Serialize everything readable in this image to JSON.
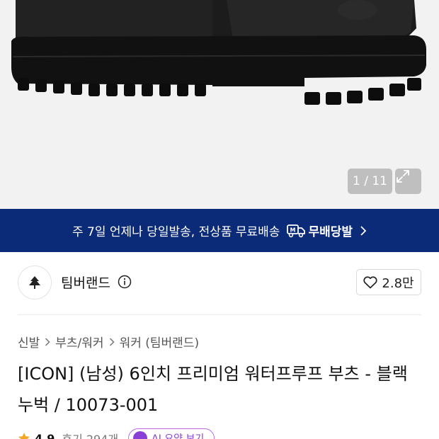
{
  "gallery": {
    "counter": "1 / 11"
  },
  "banner": {
    "message": "주 7일 언제나 당일발송, 전상품 무료배송",
    "badge": "무배당발"
  },
  "brand": {
    "name": "팀버랜드",
    "likes": "2.8만"
  },
  "breadcrumb": {
    "items": [
      "신발",
      "부츠/워커",
      "워커 (팀버랜드)"
    ]
  },
  "product": {
    "title": "[ICON] (남성) 6인치 프리미엄 워터프루프 부츠 - 블랙 누벅 / 10073-001"
  },
  "rating": {
    "score": "4.9",
    "reviews": "후기 294개",
    "pill": "AI 요약 보기"
  },
  "colors": {
    "banner_bg": "#0b2a78",
    "hero_bg": "#f2f2f3"
  }
}
